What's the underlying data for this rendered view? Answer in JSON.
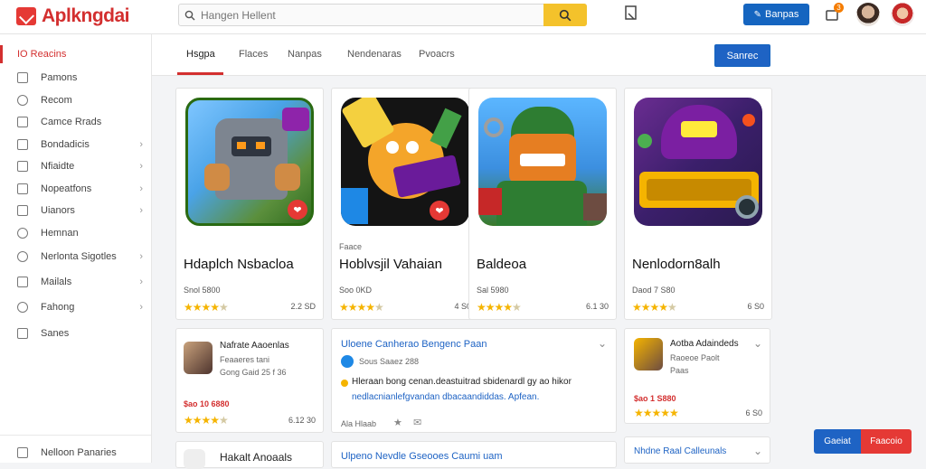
{
  "header": {
    "logo_text": "Aplkngdai",
    "search_placeholder": "Hangen Hellent",
    "upload_label": "Banpas",
    "notification_count": "3"
  },
  "sidebar": {
    "items": [
      {
        "label": "IO Reacins",
        "active": true,
        "chevron": false
      },
      {
        "label": "Pamons",
        "chevron": false
      },
      {
        "label": "Recom",
        "chevron": false
      },
      {
        "label": "Camce Rrads",
        "chevron": false
      },
      {
        "label": "Bondadicis",
        "chevron": true
      },
      {
        "label": "Nfiaidte",
        "chevron": true
      },
      {
        "label": "Nopeatfons",
        "chevron": true
      },
      {
        "label": "Uianors",
        "chevron": true
      },
      {
        "label": "Hemnan",
        "chevron": false
      },
      {
        "label": "Nerlonta Sigotles",
        "chevron": true
      },
      {
        "label": "Mailals",
        "chevron": true
      },
      {
        "label": "Fahong",
        "chevron": true
      },
      {
        "label": "Sanes",
        "chevron": false
      }
    ],
    "footer_label": "Nelloon Panaries"
  },
  "tabs": {
    "items": [
      "Hsgpa",
      "Flaces",
      "Nanpas",
      "Nendenaras",
      "Pvoacrs"
    ],
    "action_label": "Sanrec"
  },
  "games": [
    {
      "small_label": "",
      "title": "Hdaplch Nsbacloa",
      "sub": "Snol 5800",
      "rating": "2.2 SD",
      "stars": 4
    },
    {
      "small_label": "Faace",
      "title": "Hoblvsjil Vahaian",
      "sub": "Soo 0KD",
      "rating": "4 S0",
      "stars": 4
    },
    {
      "small_label": "",
      "title": "Baldeoa",
      "sub": "Sal 5980",
      "rating": "6.1 30",
      "stars": 4
    },
    {
      "small_label": "",
      "title": "Nenlodorn8alh",
      "sub": "Daod 7 S80",
      "rating": "6 S0",
      "stars": 4
    }
  ],
  "list_left": {
    "title": "Nafrate Aaoenlas",
    "sub1": "Feaaeres tani",
    "sub2": "Gong Gaid 25 f 36",
    "price": "$ao 10 6880",
    "rating": "6.12 30",
    "bottom_title": "Hakalt Anoaals"
  },
  "list_mid": {
    "title": "Uloene Canherao Bengenc Paan",
    "sub": "Sous Saaez 288",
    "desc_line1": "Hleraan bong cenan.deastuitrad sbidenardl gy ao hikor",
    "desc_line2": "nedlacnianlefgvandan dbacaandiddas. Apfean.",
    "footer": "Ala Hlaab",
    "bottom_title": "Ulpeno Nevdle Gseooes Caumi uam"
  },
  "list_right": {
    "title": "Aotba Adaindeds",
    "sub1": "Raoeoe Paolt",
    "sub2": "Paas",
    "price": "$ao 1 S880",
    "rating": "6 S0",
    "bottom_title": "Nhdne Raal Calleunals"
  },
  "floating": {
    "left": "Gaeiat",
    "right": "Faacoio"
  },
  "colors": {
    "brand_red": "#d32f2f",
    "accent_blue": "#1e63c4",
    "search_yellow": "#f4c22b",
    "star": "#f5b400"
  }
}
